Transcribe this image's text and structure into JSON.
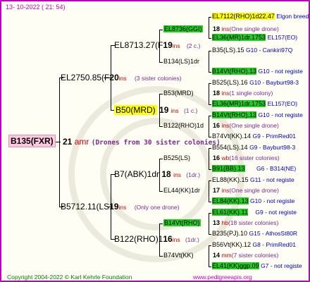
{
  "header": {
    "date": "13- 10-2022 ( 21: 54)"
  },
  "root": {
    "name": "B135(FXR)",
    "gen": "21",
    "ins": "amr",
    "note": "(Drones from 30 sister colonies)"
  },
  "gen1": [
    {
      "name": "EL2750.85(F",
      "gen": "20",
      "ins": "ins",
      "note": "(3 sister colonies)"
    },
    {
      "name": "B5712.11(LS",
      "gen": "19",
      "ins": "ins",
      "note": "(Only one drone)"
    }
  ],
  "gen2": [
    {
      "name": "EL8713.27(F",
      "gen": "19",
      "ins": "ins",
      "note": "(2 c.)"
    },
    {
      "name": "B50(MRD)",
      "gen": "19",
      "ins": "ins",
      "note": "(1 c.)"
    },
    {
      "name": "B7(ABK)1dr",
      "gen": "18",
      "ins": "ins",
      "note": "(1dr.)"
    },
    {
      "name": "B122(RHO)1",
      "gen": "16",
      "ins": "ins",
      "note": "(1dr.)"
    }
  ],
  "gen3": [
    {
      "name": "EL8736(GGI)",
      "gen": "18",
      "ins": "ins",
      "note": "(One single drone)"
    },
    {
      "name": "B134(LS)1dr",
      "gen": "",
      "ins": "",
      "note": ""
    },
    {
      "name": "B53(MRD)",
      "gen": "18",
      "ins": "ins",
      "note": "(1 single colony)"
    },
    {
      "name": "B122(RHO)1d",
      "gen": "16",
      "ins": "ins",
      "note": "(One single drone)"
    },
    {
      "name": "B525(LS)",
      "gen": "16",
      "ins": "wb",
      "note": "(16 sister colonies)"
    },
    {
      "name": "EL44(KK)1dr",
      "gen": "17",
      "ins": "ins",
      "note": "(One single drone)"
    },
    {
      "name": "B14Vt(RHO)",
      "gen": "13",
      "ins": "hb",
      "note": "(18 sister colonies)"
    },
    {
      "name": "B74Vt(KK)",
      "gen": "14",
      "ins": "mm",
      "note": "(7 sister colonies)"
    }
  ],
  "gen4": [
    {
      "name": "EL7112(RHO)1d",
      "extra": "22.47",
      "src": "Elgon breed"
    },
    {
      "name": "EL36(MR)1dr.17",
      "extra": "53",
      "src": "EL157(EO)"
    },
    {
      "name": "B35(LS).15",
      "extra": "",
      "src": "G10 - Cankiri97Q"
    },
    {
      "name": "B14Vt(RHO).13",
      "extra": "",
      "src": "G10 - not registe"
    },
    {
      "name": "B525(LS).16",
      "extra": "",
      "src": "G10 - Bayburt98-3"
    },
    {
      "name": "EL36(MR)1dr.17",
      "extra": "53",
      "src": "EL157(EO)"
    },
    {
      "name": "B14Vt(RHO).13",
      "extra": "",
      "src": "G10 - not registe"
    },
    {
      "name": "B74Vt(KK).14",
      "extra": "",
      "src": "G9 - PrimRed01"
    },
    {
      "name": "B554(LS).14",
      "extra": "",
      "src": "G9 - Bayburt98-3"
    },
    {
      "name": "B91(BB).13",
      "extra": "",
      "src": "G6 - B314(NE)"
    },
    {
      "name": "EL88(KK).15",
      "extra": "",
      "src": "G11 - not registe"
    },
    {
      "name": "EL84(KK).13",
      "extra": "",
      "src": "G10 - not registe"
    },
    {
      "name": "EL61(KK).11",
      "extra": "",
      "src": "G9 - not registe"
    },
    {
      "name": "B235(PJ).10",
      "extra": "",
      "src": "G15 - AthosSt80R"
    },
    {
      "name": "B56Vt(KK).12",
      "extra": "",
      "src": "G8 - PrimRed01"
    },
    {
      "name": "EL41(KK)ggp.09",
      "extra": "",
      "src": "G7 - not registe"
    }
  ],
  "footer": {
    "copyright": "Copyright 2004-2022 © Karl Kehrle Foundation",
    "site": "www.pedigreeapis.org"
  },
  "colors": {
    "frame": "#c000c0",
    "highlight_yellow": "#ffff00",
    "highlight_green": "#22cc22",
    "root_bg": "#ffc8e0"
  }
}
